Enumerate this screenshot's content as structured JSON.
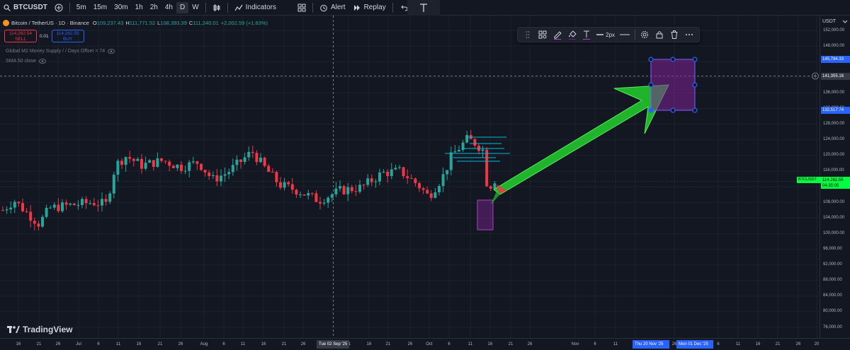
{
  "toolbar": {
    "symbol": "BTCUSDT",
    "intervals": [
      "5m",
      "15m",
      "30m",
      "1h",
      "2h",
      "4h",
      "D",
      "W"
    ],
    "active_interval": "D",
    "indicators_label": "Indicators",
    "alert_label": "Alert",
    "replay_label": "Replay"
  },
  "legend": {
    "title": "Bitcoin / TetherUS · 1D · Binance",
    "open_label": "O",
    "open": "109,237.43",
    "high_label": "H",
    "high": "111,771.52",
    "low_label": "L",
    "low": "108,393.39",
    "close_label": "C",
    "close": "111,240.01",
    "change": "+2,002.59 (+1.83%)",
    "sell_price": "114,262.54",
    "sell_label": "SELL",
    "spread": "0.01",
    "buy_price": "114,262.55",
    "buy_label": "BUY",
    "indicator1": "Global M2 Money Supply / / Days Offset = 74",
    "indicator2": "SMA 50 close"
  },
  "drawing_toolbar": {
    "width_label": "2px"
  },
  "price_axis": {
    "currency": "USDT",
    "labels": [
      "152,000.00",
      "148,000.00",
      "144,000.00",
      "140,000.00",
      "136,000.00",
      "132,000.00",
      "128,000.00",
      "124,000.00",
      "120,000.00",
      "116,000.00",
      "112,000.00",
      "108,000.00",
      "104,000.00",
      "100,000.00",
      "96,000.00",
      "92,000.00",
      "88,000.00",
      "84,000.00",
      "80,000.00",
      "76,000.00"
    ],
    "tag_rect_top": "145,794.33",
    "tag_crosshair": "141,355.16",
    "tag_rect_bottom": "132,517.74",
    "tag_symbol": "BTCUSDT",
    "tag_last": "114,262.55",
    "tag_countdown": "04:35:05"
  },
  "time_axis": {
    "labels": [
      "16",
      "21",
      "26",
      "Jul",
      "6",
      "11",
      "16",
      "21",
      "26",
      "Aug",
      "6",
      "11",
      "16",
      "21",
      "26",
      "11",
      "16",
      "21",
      "26",
      "Oct",
      "6",
      "11",
      "16",
      "21",
      "26",
      "Nov",
      "6",
      "11",
      "16",
      "26",
      "6",
      "11",
      "16",
      "21",
      "26",
      "20"
    ],
    "tag_crosshair": "Tue 02 Sep '25",
    "tag_range_start": "Thu 20 Nov '25",
    "tag_range_end": "Mon 01 Dec '25"
  },
  "branding": {
    "logo_text": "TradingView"
  },
  "colors": {
    "up": "#26a69a",
    "down": "#f23645",
    "arrow": "#2ecc40",
    "box": "#9c27b0",
    "cyan": "#00bcd4"
  },
  "chart_data": {
    "type": "candlestick",
    "symbol": "BTCUSDT",
    "interval": "1D",
    "ylim": [
      74000,
      154000
    ],
    "approx_closes": [
      {
        "date": "2025-06-16",
        "close": 107000
      },
      {
        "date": "2025-07-01",
        "close": 107500
      },
      {
        "date": "2025-07-14",
        "close": 119800
      },
      {
        "date": "2025-08-14",
        "close": 118500
      },
      {
        "date": "2025-09-01",
        "close": 108200
      },
      {
        "date": "2025-10-06",
        "close": 124500
      },
      {
        "date": "2025-10-11",
        "close": 111200
      },
      {
        "date": "2025-10-14",
        "close": 114262
      }
    ],
    "annotations": [
      {
        "type": "rectangle",
        "from_date": "2025-11-20",
        "to_date": "2025-12-01",
        "from_price": 132517.74,
        "to_price": 145794.33
      },
      {
        "type": "rectangle",
        "from_date": "2025-10-10",
        "to_date": "2025-10-13",
        "from_price": 101500,
        "to_price": 109000
      },
      {
        "type": "arrow",
        "from_date": "2025-10-14",
        "from_price": 112000,
        "to_date": "2025-11-22",
        "to_price": 141000
      }
    ]
  }
}
